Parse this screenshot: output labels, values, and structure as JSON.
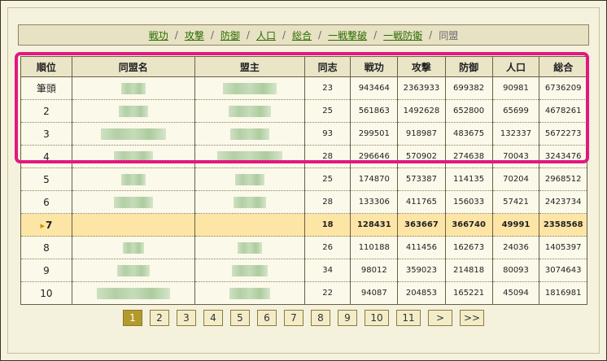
{
  "tabs": [
    {
      "label": "戦功",
      "current": false
    },
    {
      "label": "攻撃",
      "current": false
    },
    {
      "label": "防御",
      "current": false
    },
    {
      "label": "人口",
      "current": false
    },
    {
      "label": "総合",
      "current": false
    },
    {
      "label": "一戦撃破",
      "current": false
    },
    {
      "label": "一戦防衛",
      "current": false
    },
    {
      "label": "同盟",
      "current": true
    }
  ],
  "tab_separator": "/",
  "table": {
    "headers": [
      "順位",
      "同盟名",
      "盟主",
      "同志",
      "戦功",
      "攻撃",
      "防御",
      "人口",
      "総合"
    ],
    "rows": [
      {
        "rank": "筆頭",
        "members": "23",
        "merit": "943464",
        "attack": "2363933",
        "defense": "699382",
        "population": "90981",
        "total": "6736209"
      },
      {
        "rank": "2",
        "members": "25",
        "merit": "561863",
        "attack": "1492628",
        "defense": "652800",
        "population": "65699",
        "total": "4678261"
      },
      {
        "rank": "3",
        "members": "93",
        "merit": "299501",
        "attack": "918987",
        "defense": "483675",
        "population": "132337",
        "total": "5672273"
      },
      {
        "rank": "4",
        "members": "28",
        "merit": "296646",
        "attack": "570902",
        "defense": "274638",
        "population": "70043",
        "total": "3243476"
      },
      {
        "rank": "5",
        "members": "25",
        "merit": "174870",
        "attack": "573387",
        "defense": "114135",
        "population": "70204",
        "total": "2968512"
      },
      {
        "rank": "6",
        "members": "28",
        "merit": "133306",
        "attack": "411765",
        "defense": "156033",
        "population": "57421",
        "total": "2423734"
      },
      {
        "rank": "7",
        "members": "18",
        "merit": "128431",
        "attack": "363667",
        "defense": "366740",
        "population": "49991",
        "total": "2358568",
        "own": true
      },
      {
        "rank": "8",
        "members": "26",
        "merit": "110188",
        "attack": "411456",
        "defense": "162673",
        "population": "24036",
        "total": "1405397"
      },
      {
        "rank": "9",
        "members": "34",
        "merit": "98012",
        "attack": "359023",
        "defense": "214818",
        "population": "80093",
        "total": "3074643"
      },
      {
        "rank": "10",
        "members": "22",
        "merit": "94087",
        "attack": "204853",
        "defense": "165221",
        "population": "45094",
        "total": "1816981"
      }
    ]
  },
  "pagination": {
    "pages": [
      "1",
      "2",
      "3",
      "4",
      "5",
      "6",
      "7",
      "8",
      "9",
      "10",
      "11"
    ],
    "current": "1",
    "next": ">",
    "last": ">>"
  },
  "colors": {
    "highlight": "#e4177f",
    "own_row": "#fde5a6",
    "link": "#2a6a00",
    "pager_active": "#b39a2e"
  },
  "icons": {
    "own_row_marker": "arrow-icon"
  }
}
